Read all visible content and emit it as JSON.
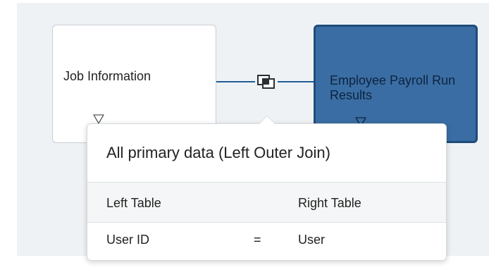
{
  "nodes": {
    "left_table": {
      "title": "Job Information",
      "icon": "filter-icon"
    },
    "right_table": {
      "title": "Employee Payroll Run Results",
      "icon": "filter-icon"
    }
  },
  "join": {
    "icon": "join-icon",
    "line_color": "#1f5d96"
  },
  "popover": {
    "title": "All primary data (Left Outer Join)",
    "columns": {
      "left": "Left Table",
      "right": "Right Table"
    },
    "conditions": [
      {
        "left": "User ID",
        "operator": "=",
        "right": "User"
      }
    ]
  },
  "colors": {
    "canvas_bg": "#eff2f5",
    "selected_node_bg": "#3a6da3",
    "selected_node_border": "#1f4c7a",
    "accent": "#1f5d96"
  }
}
